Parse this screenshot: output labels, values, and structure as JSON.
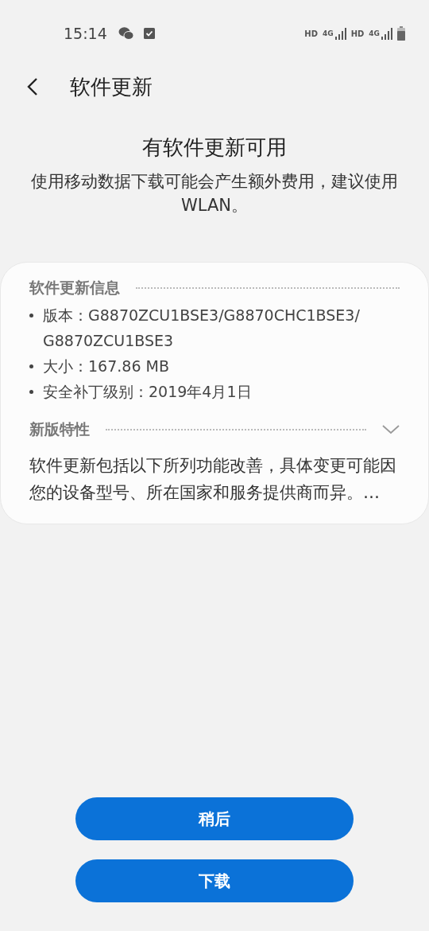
{
  "status_bar": {
    "time": "15:14",
    "sim1": {
      "hd": "HD",
      "network": "4G"
    },
    "sim2": {
      "hd": "HD",
      "network": "4G"
    }
  },
  "header": {
    "title": "软件更新"
  },
  "intro": {
    "heading": "有软件更新可用",
    "message": "使用移动数据下载可能会产生额外费用，建议使用 WLAN。"
  },
  "info_card": {
    "info_heading": "软件更新信息",
    "info_items": [
      {
        "label": "版本：",
        "value": "G8870ZCU1BSE3/G8870CHC1BSE3/ G8870ZCU1BSE3"
      },
      {
        "label": "大小：",
        "value": "167.86 MB"
      },
      {
        "label": "安全补丁级别：",
        "value": "2019年4月1日"
      }
    ],
    "features_heading": "新版特性",
    "features_text": "软件更新包括以下所列功能改善，具体变更可能因您的设备型号、所在国家和服务提供商而异。…"
  },
  "buttons": [
    "稍后",
    "下载"
  ]
}
